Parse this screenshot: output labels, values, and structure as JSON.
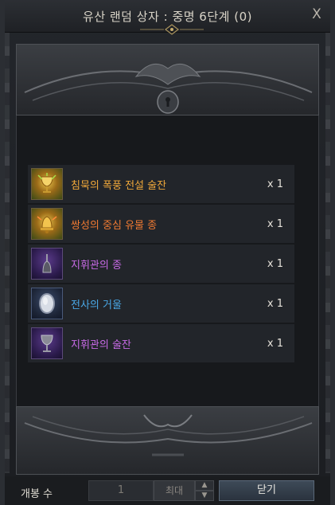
{
  "window": {
    "title": "유산 랜덤 상자 : 중명 6단계 (0)",
    "close_icon": "X"
  },
  "items": [
    {
      "name": "침묵의 폭풍 전설 술잔",
      "qty": "x 1",
      "color": "#f0a83a",
      "icon": "gold-chalice-icon",
      "frame": "gold"
    },
    {
      "name": "쌍성의 중심 유물 종",
      "qty": "x 1",
      "color": "#f07a32",
      "icon": "gold-bell-icon",
      "frame": "gold"
    },
    {
      "name": "지휘관의 종",
      "qty": "x 1",
      "color": "#c86ae6",
      "icon": "bell-icon",
      "frame": "purple"
    },
    {
      "name": "전사의 거울",
      "qty": "x 1",
      "color": "#4aa8e6",
      "icon": "mirror-icon",
      "frame": "blue"
    },
    {
      "name": "지휘관의 술잔",
      "qty": "x 1",
      "color": "#c86ae6",
      "icon": "chalice-icon",
      "frame": "purple"
    }
  ],
  "footer": {
    "open_count_label": "개봉 수",
    "quantity_value": "1",
    "max_label": "최대",
    "close_label": "닫기"
  }
}
